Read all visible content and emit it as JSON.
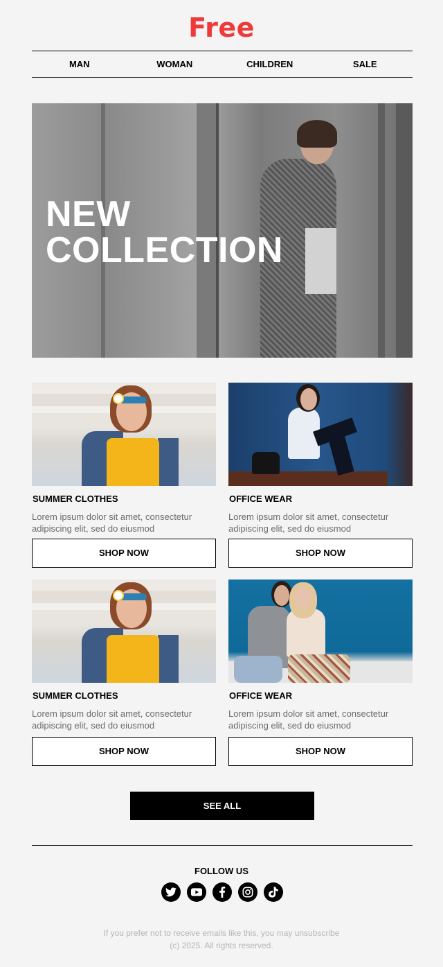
{
  "brand": {
    "logo": "Free",
    "logo_color": "#ef3a3a"
  },
  "nav": {
    "items": [
      "MAN",
      "WOMAN",
      "CHILDREN",
      "SALE"
    ]
  },
  "hero": {
    "line1": "NEW",
    "line2": "COLLECTION"
  },
  "cards": [
    {
      "title": "SUMMER CLOTHES",
      "text": "Lorem ipsum dolor sit amet, consectetur adipiscing elit, sed do eiusmod",
      "button": "SHOP NOW"
    },
    {
      "title": "OFFICE WEAR",
      "text": "Lorem ipsum dolor sit amet, consectetur adipiscing elit, sed do eiusmod",
      "button": "SHOP NOW"
    },
    {
      "title": "SUMMER CLOTHES",
      "text": "Lorem ipsum dolor sit amet, consectetur adipiscing elit, sed do eiusmod",
      "button": "SHOP NOW"
    },
    {
      "title": "OFFICE WEAR",
      "text": "Lorem ipsum dolor sit amet, consectetur adipiscing elit, sed do eiusmod",
      "button": "SHOP NOW"
    }
  ],
  "see_all": "SEE ALL",
  "footer": {
    "follow": "FOLLOW US",
    "socials": [
      "twitter-icon",
      "youtube-icon",
      "facebook-icon",
      "instagram-icon",
      "tiktok-icon"
    ],
    "unsubscribe": "If you prefer not to receive emails like this, you may unsubscribe",
    "copyright": "(c) 2025. All rights reserved."
  }
}
